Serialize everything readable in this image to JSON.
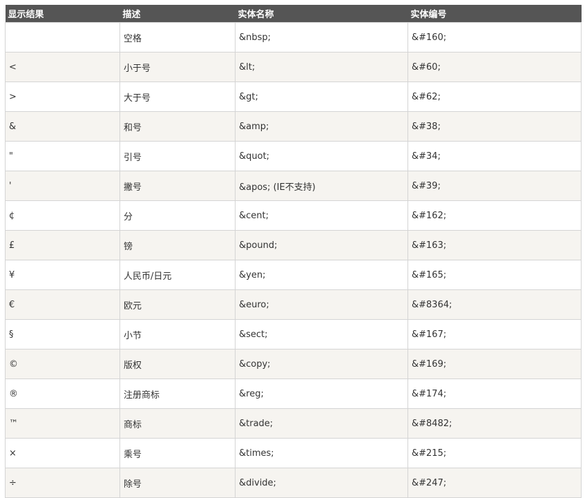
{
  "table": {
    "headers": [
      "显示结果",
      "描述",
      "实体名称",
      "实体编号"
    ],
    "rows": [
      [
        " ",
        "空格",
        "&nbsp;",
        "&#160;"
      ],
      [
        "<",
        "小于号",
        "&lt;",
        "&#60;"
      ],
      [
        ">",
        "大于号",
        "&gt;",
        "&#62;"
      ],
      [
        "&",
        "和号",
        "&amp;",
        "&#38;"
      ],
      [
        "\"",
        "引号",
        "&quot;",
        "&#34;"
      ],
      [
        "'",
        "撇号",
        "&apos; (IE不支持)",
        "&#39;"
      ],
      [
        "¢",
        "分",
        "&cent;",
        "&#162;"
      ],
      [
        "£",
        "镑",
        "&pound;",
        "&#163;"
      ],
      [
        "¥",
        "人民币/日元",
        "&yen;",
        "&#165;"
      ],
      [
        "€",
        "欧元",
        "&euro;",
        "&#8364;"
      ],
      [
        "§",
        "小节",
        "&sect;",
        "&#167;"
      ],
      [
        "©",
        "版权",
        "&copy;",
        "&#169;"
      ],
      [
        "®",
        "注册商标",
        "&reg;",
        "&#174;"
      ],
      [
        "™",
        "商标",
        "&trade;",
        "&#8482;"
      ],
      [
        "×",
        "乘号",
        "&times;",
        "&#215;"
      ],
      [
        "÷",
        "除号",
        "&divide;",
        "&#247;"
      ]
    ]
  },
  "colors": {
    "header_bg": "#555555",
    "header_text": "#ffffff",
    "row_alt_bg": "#f6f4f0",
    "border": "#d4d4d4"
  }
}
